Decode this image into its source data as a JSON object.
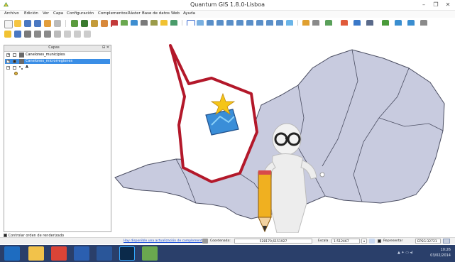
{
  "window": {
    "title": "Quantum GIS 1.8.0-Lisboa"
  },
  "menubar": {
    "items": [
      "Archivo",
      "Edición",
      "Ver",
      "Capa",
      "Configuración",
      "Complementos",
      "Ráster",
      "Base de datos",
      "Web",
      "Ayuda"
    ]
  },
  "layers_panel": {
    "title": "Capas",
    "close_glyph": "⊟ ✕",
    "items": [
      {
        "label": "Canelones_municipios"
      },
      {
        "label": "Canelones_microrregiones"
      },
      {
        "label": "A"
      }
    ]
  },
  "render_order": {
    "label": "Controlar orden de renderizado"
  },
  "statusbar": {
    "update_link": "Hay disponible una actualización de complemento",
    "coord_label": "Coordenada:",
    "coord_value": "528170,6151927",
    "scale_label": "Escala",
    "scale_value": "1:512467",
    "render_label": "Representar",
    "epsg": "EPSG:32721"
  },
  "taskbar": {
    "time": "10:26",
    "date": "03/02/2014"
  },
  "colors": {
    "map_fill": "#c8cbdf",
    "map_stroke": "#4a4d61",
    "callout": "#b3182a",
    "selection": "#3a8ee6",
    "link": "#1a4fd6",
    "taskbar": "#2a3f6a"
  },
  "icons": {
    "app": "qgis-icon",
    "callout_icon": "add-vector-layer-star-icon",
    "figure": "3d-man-with-pencil-illustration"
  }
}
